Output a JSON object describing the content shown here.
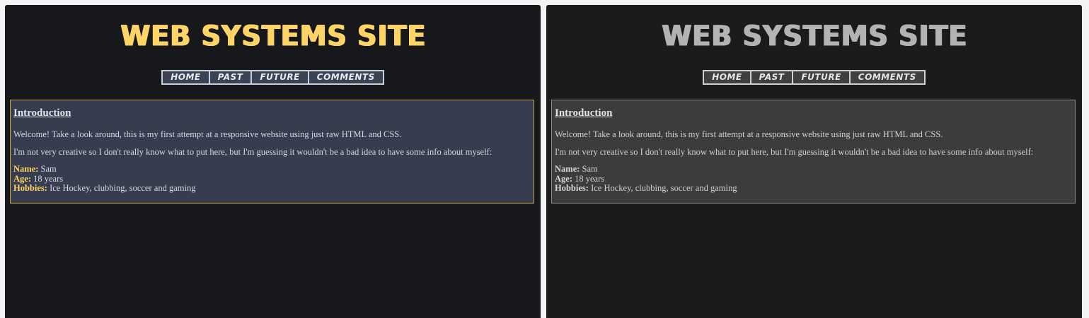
{
  "site": {
    "title": "WEB SYSTEMS SITE"
  },
  "nav": {
    "items": [
      "HOME",
      "PAST",
      "FUTURE",
      "COMMENTS"
    ]
  },
  "content": {
    "heading": "Introduction",
    "paragraph1": "Welcome! Take a look around, this is my first attempt at a responsive website using just raw HTML and CSS.",
    "paragraph2": "I'm not very creative so I don't really know what to put here, but I'm guessing it wouldn't be a bad idea to have some info about myself:",
    "info": [
      {
        "label": "Name:",
        "value": "Sam"
      },
      {
        "label": "Age:",
        "value": "18 years"
      },
      {
        "label": "Hobbies:",
        "value": "Ice Hockey, clubbing, soccer and gaming"
      }
    ]
  },
  "themes": {
    "left": {
      "accent": "#ffd466",
      "background": "#17181c",
      "box": "#373d4f"
    },
    "right": {
      "accent": "#b3b3b3",
      "background": "#1b1b1b",
      "box": "#3c3c3c"
    }
  }
}
